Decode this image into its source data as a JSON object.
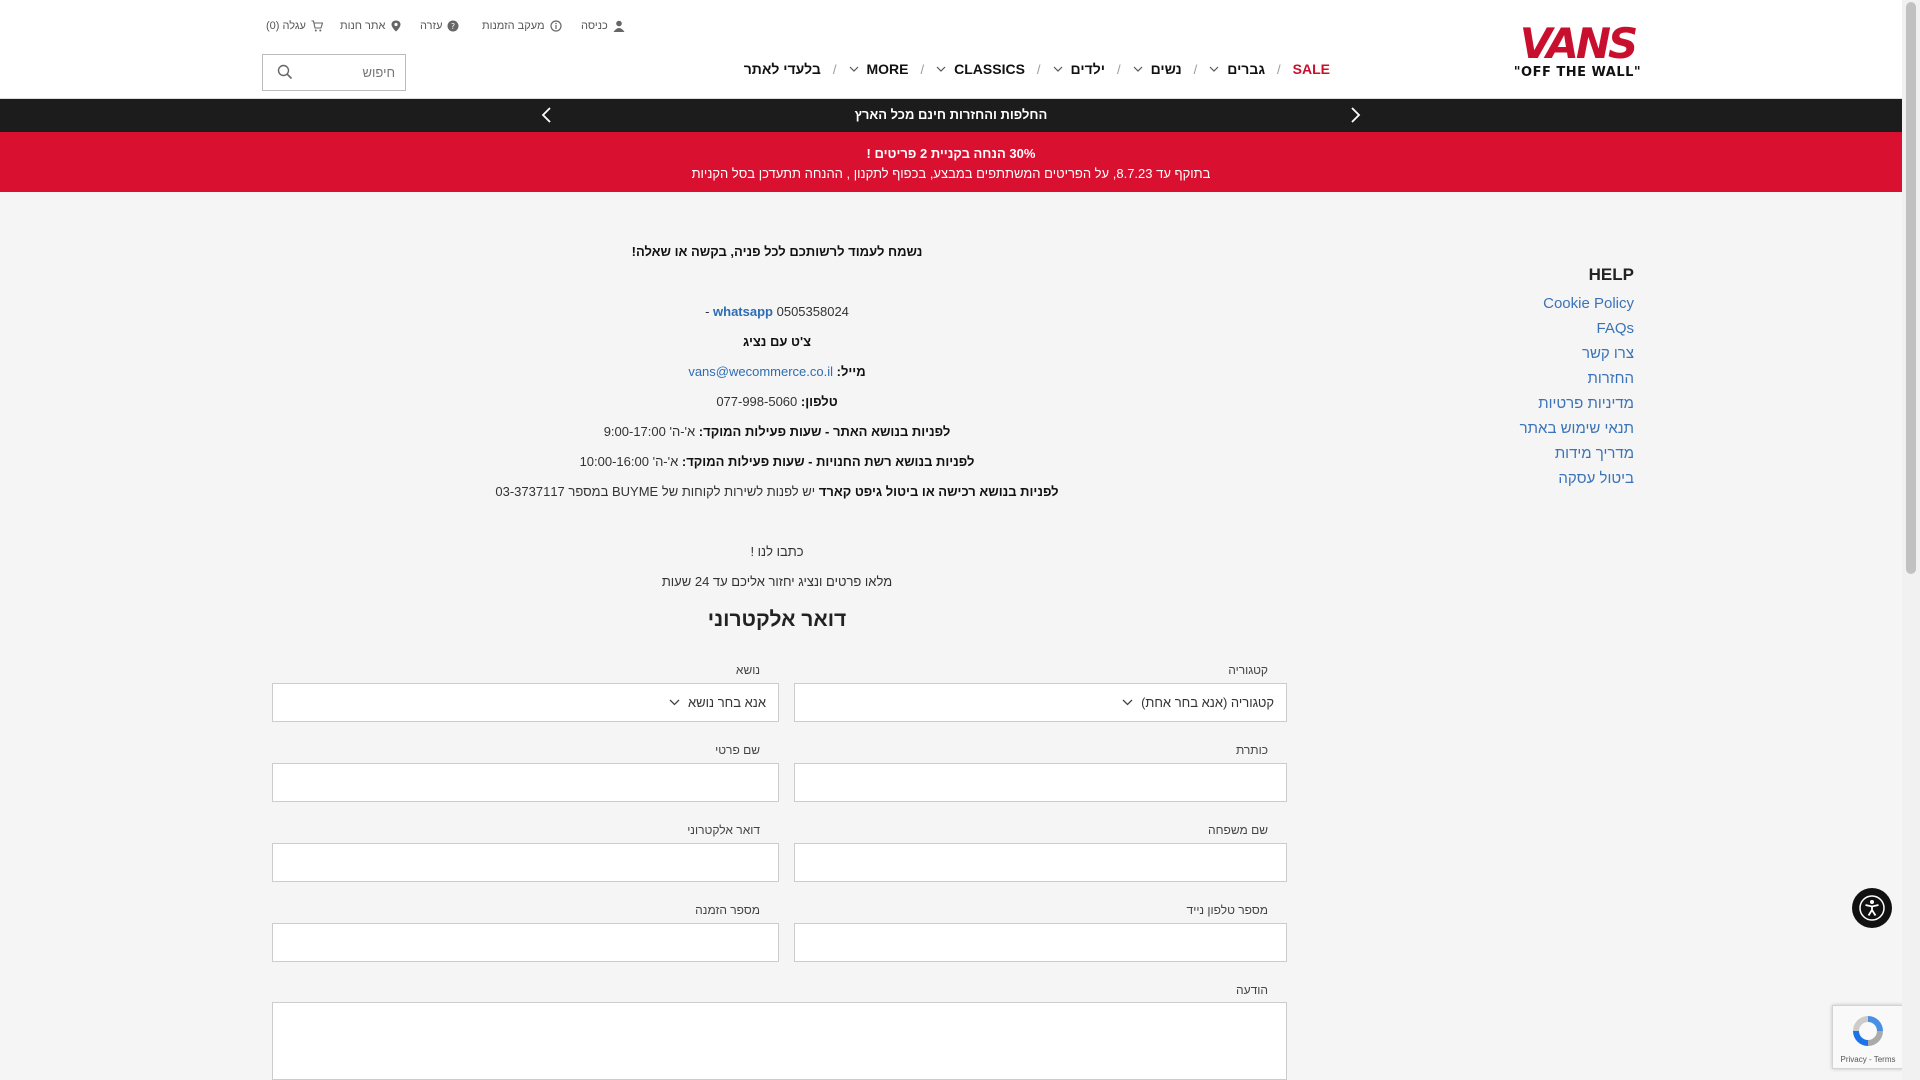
{
  "header": {
    "logo_word": "VANS",
    "logo_tagline": "\"OFF THE WALL\"",
    "utility": {
      "login": "כניסה",
      "order_tracking": "מעקב הזמנות",
      "help": "עזרה",
      "store_locator": "אתר חנות",
      "cart": "עגלה (0)"
    },
    "nav": [
      {
        "label": "SALE",
        "sale": true,
        "dropdown": false
      },
      {
        "label": "גברים",
        "dropdown": true
      },
      {
        "label": "נשים",
        "dropdown": true
      },
      {
        "label": "ילדים",
        "dropdown": true
      },
      {
        "label": "CLASSICS",
        "dropdown": true
      },
      {
        "label": "MORE",
        "dropdown": true
      },
      {
        "label": "בלעדי לאתר",
        "dropdown": false
      }
    ],
    "search_placeholder": "חיפוש"
  },
  "promo": {
    "black_bar_text": "החלפות והחזרות חינם מכל הארץ",
    "red_line1": "30% הנחה בקניית 2 פריטים !",
    "red_line2": "בתוקף עד 8.7.23, על הפריטים המשתתפים במבצע, בכפוף לתקנון , ההנחה תתעדכן בסל הקניות"
  },
  "help_sidebar": {
    "title": "HELP",
    "links": [
      "Cookie Policy",
      "FAQs",
      "צרו קשר",
      "החזרות",
      "מדיניות פרטיות",
      "תנאי שימוש באתר",
      "מדריך מידות",
      "ביטול עסקה"
    ]
  },
  "contact": {
    "intro": "נשמח לעמוד לרשותכם לכל פניה, בקשה או שאלה!",
    "whatsapp_label": "whatsapp",
    "whatsapp_number": "0505358024 -",
    "chat": "צ'ט עם נציג",
    "mail_label": "מייל:",
    "mail_value": "vans@wecommerce.co.il",
    "phone_label": "טלפון:",
    "phone_value": "077-998-5060",
    "site_hours_label": "לפניות בנושא האתר - שעות פעילות המוקד:",
    "site_hours_value": "א'-ה' 9:00-17:00",
    "stores_hours_label": "לפניות בנושא רשת החנויות - שעות פעילות המוקד:",
    "stores_hours_value": "א'-ה' 10:00-16:00",
    "giftcard_label": "לפניות בנושא רכישה או ביטול גיפט קארד",
    "giftcard_value": "יש לפנות לשירות לקוחות של BUYME במספר 03-3737117",
    "write_us": "כתבו לנו !",
    "write_us_sub": "מלאו פרטים ונציג יחזור אליכם עד 24 שעות"
  },
  "form": {
    "title": "דואר אלקטרוני",
    "category_label": "קטגוריה",
    "category_value": "קטגוריה (אנא בחר אחת)",
    "subject_label": "נושא",
    "subject_value": "אנא בחר נושא",
    "title_label": "כותרת",
    "first_name_label": "שם פרטי",
    "last_name_label": "שם משפחה",
    "email_label": "דואר אלקטרוני",
    "mobile_label": "מספר טלפון נייד",
    "order_label": "מספר הזמנה",
    "message_label": "הודעה"
  },
  "recaptcha_text": "Privacy - Terms",
  "colors": {
    "brand_red": "#c8102e",
    "promo_red": "#d9102f",
    "link_blue": "#3a73b8"
  }
}
